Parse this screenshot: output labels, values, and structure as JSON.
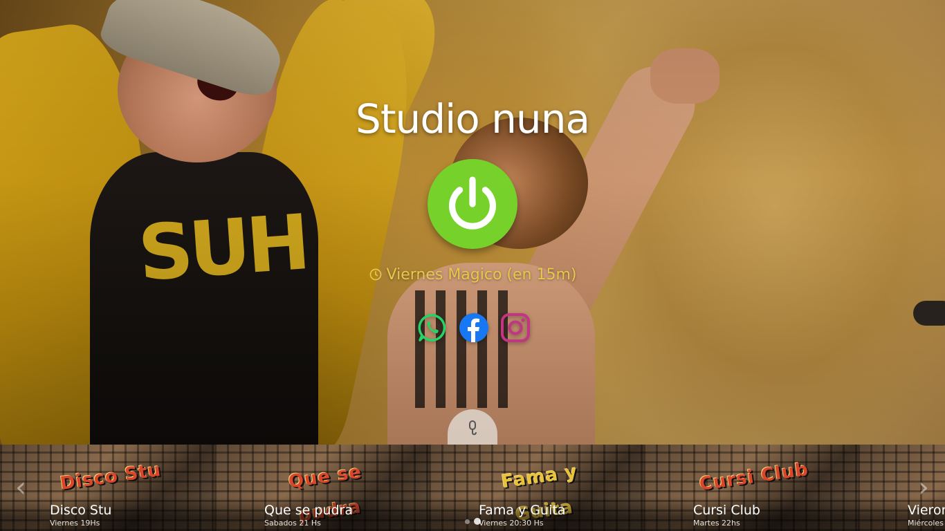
{
  "station": {
    "title": "Studio nuna"
  },
  "player": {
    "power_icon": "power-icon",
    "power_color": "#76d12a"
  },
  "schedule": {
    "text": "Viernes Magico (en 15m)",
    "icon": "clock-icon",
    "color": "#e7c84a"
  },
  "socials": [
    {
      "name": "whatsapp",
      "icon": "whatsapp-icon",
      "color": "#25d366"
    },
    {
      "name": "facebook",
      "icon": "facebook-icon",
      "color": "#1877f2"
    },
    {
      "name": "instagram",
      "icon": "instagram-icon",
      "color": "#c13584"
    }
  ],
  "mic": {
    "icon": "microphone-icon"
  },
  "carousel": {
    "prev_icon": "chevron-left-icon",
    "next_icon": "chevron-right-icon",
    "prev_symbol": "‹",
    "next_symbol": "›",
    "slides": [
      {
        "name": "Disco Stu",
        "when": "Viernes 19Hs",
        "logo": "Disco Stu"
      },
      {
        "name": "Que se pudra",
        "when": "Sabados 21 Hs",
        "logo": "Que se pudra"
      },
      {
        "name": "Fama y Guita",
        "when": "Viernes 20:30 Hs",
        "logo": "Fama y Guita"
      },
      {
        "name": "Cursi Club",
        "when": "Martes 22hs",
        "logo": "Cursi Club"
      },
      {
        "name": "Vieron",
        "when": "Miércoles",
        "logo": ""
      }
    ],
    "pages": 2,
    "active_page": 2
  }
}
